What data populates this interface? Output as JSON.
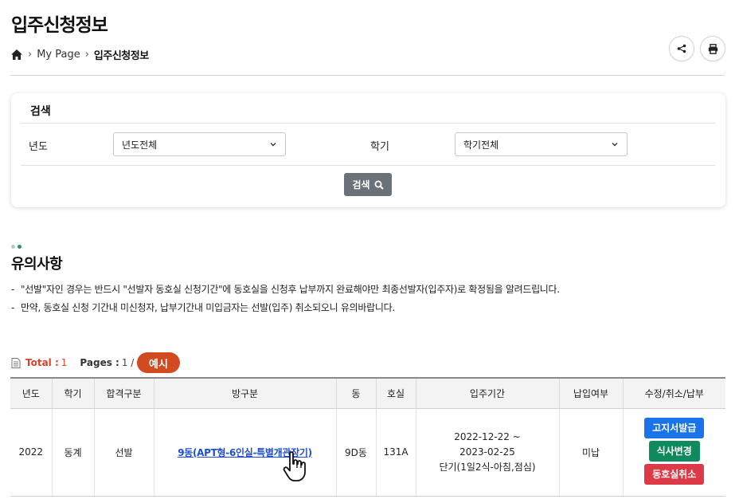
{
  "page": {
    "title": "입주신청정보"
  },
  "breadcrumb": {
    "home_icon": "home-icon",
    "items": [
      "My Page",
      "입주신청정보"
    ]
  },
  "toolbar": {
    "share_icon": "share-icon",
    "print_icon": "print-icon"
  },
  "search": {
    "title": "검색",
    "year_label": "년도",
    "year_value": "년도전체",
    "term_label": "학기",
    "term_value": "학기전체",
    "button_label": "검색"
  },
  "notice": {
    "title": "유의사항",
    "lines": [
      "\"선발\"자인 경우는 반드시 \"선발자 동호실 신청기간\"에 동호실을 신청후 납부까지 완료해야만 최종선발자(입주자)로 확정됨을 알려드립니다.",
      "만약, 동호실 신청 기간내 미신청자, 납부기간내 미입금자는 선발(입주) 취소되오니 유의바랍니다."
    ]
  },
  "summary": {
    "total_label": "Total :",
    "total_value": "1",
    "pages_label": "Pages :",
    "pages_value": "1 / 1",
    "example_badge": "예시"
  },
  "table": {
    "headers": [
      "년도",
      "학기",
      "합격구분",
      "방구분",
      "동",
      "호실",
      "입주기간",
      "납입여부",
      "수정/취소/납부"
    ],
    "rows": [
      {
        "year": "2022",
        "term": "동계",
        "pass_type": "선발",
        "room_type": "9동(APT형-6인실-특별개관장기)",
        "building": "9D동",
        "room": "131A",
        "period_start": "2022-12-22 ~",
        "period_end": "2023-02-25",
        "period_meal": "단기(1일2식-아침,점심)",
        "paid": "미납",
        "actions": [
          "고지서발급",
          "식사변경",
          "동호실취소"
        ]
      }
    ]
  },
  "colors": {
    "accent_red": "#d24a20",
    "total_red": "#d9412b",
    "link_blue": "#1f4fd1",
    "btn_blue": "#1a73e8",
    "btn_green": "#0e8a5c",
    "btn_red": "#de3946",
    "search_btn_gray": "#6b7178"
  }
}
